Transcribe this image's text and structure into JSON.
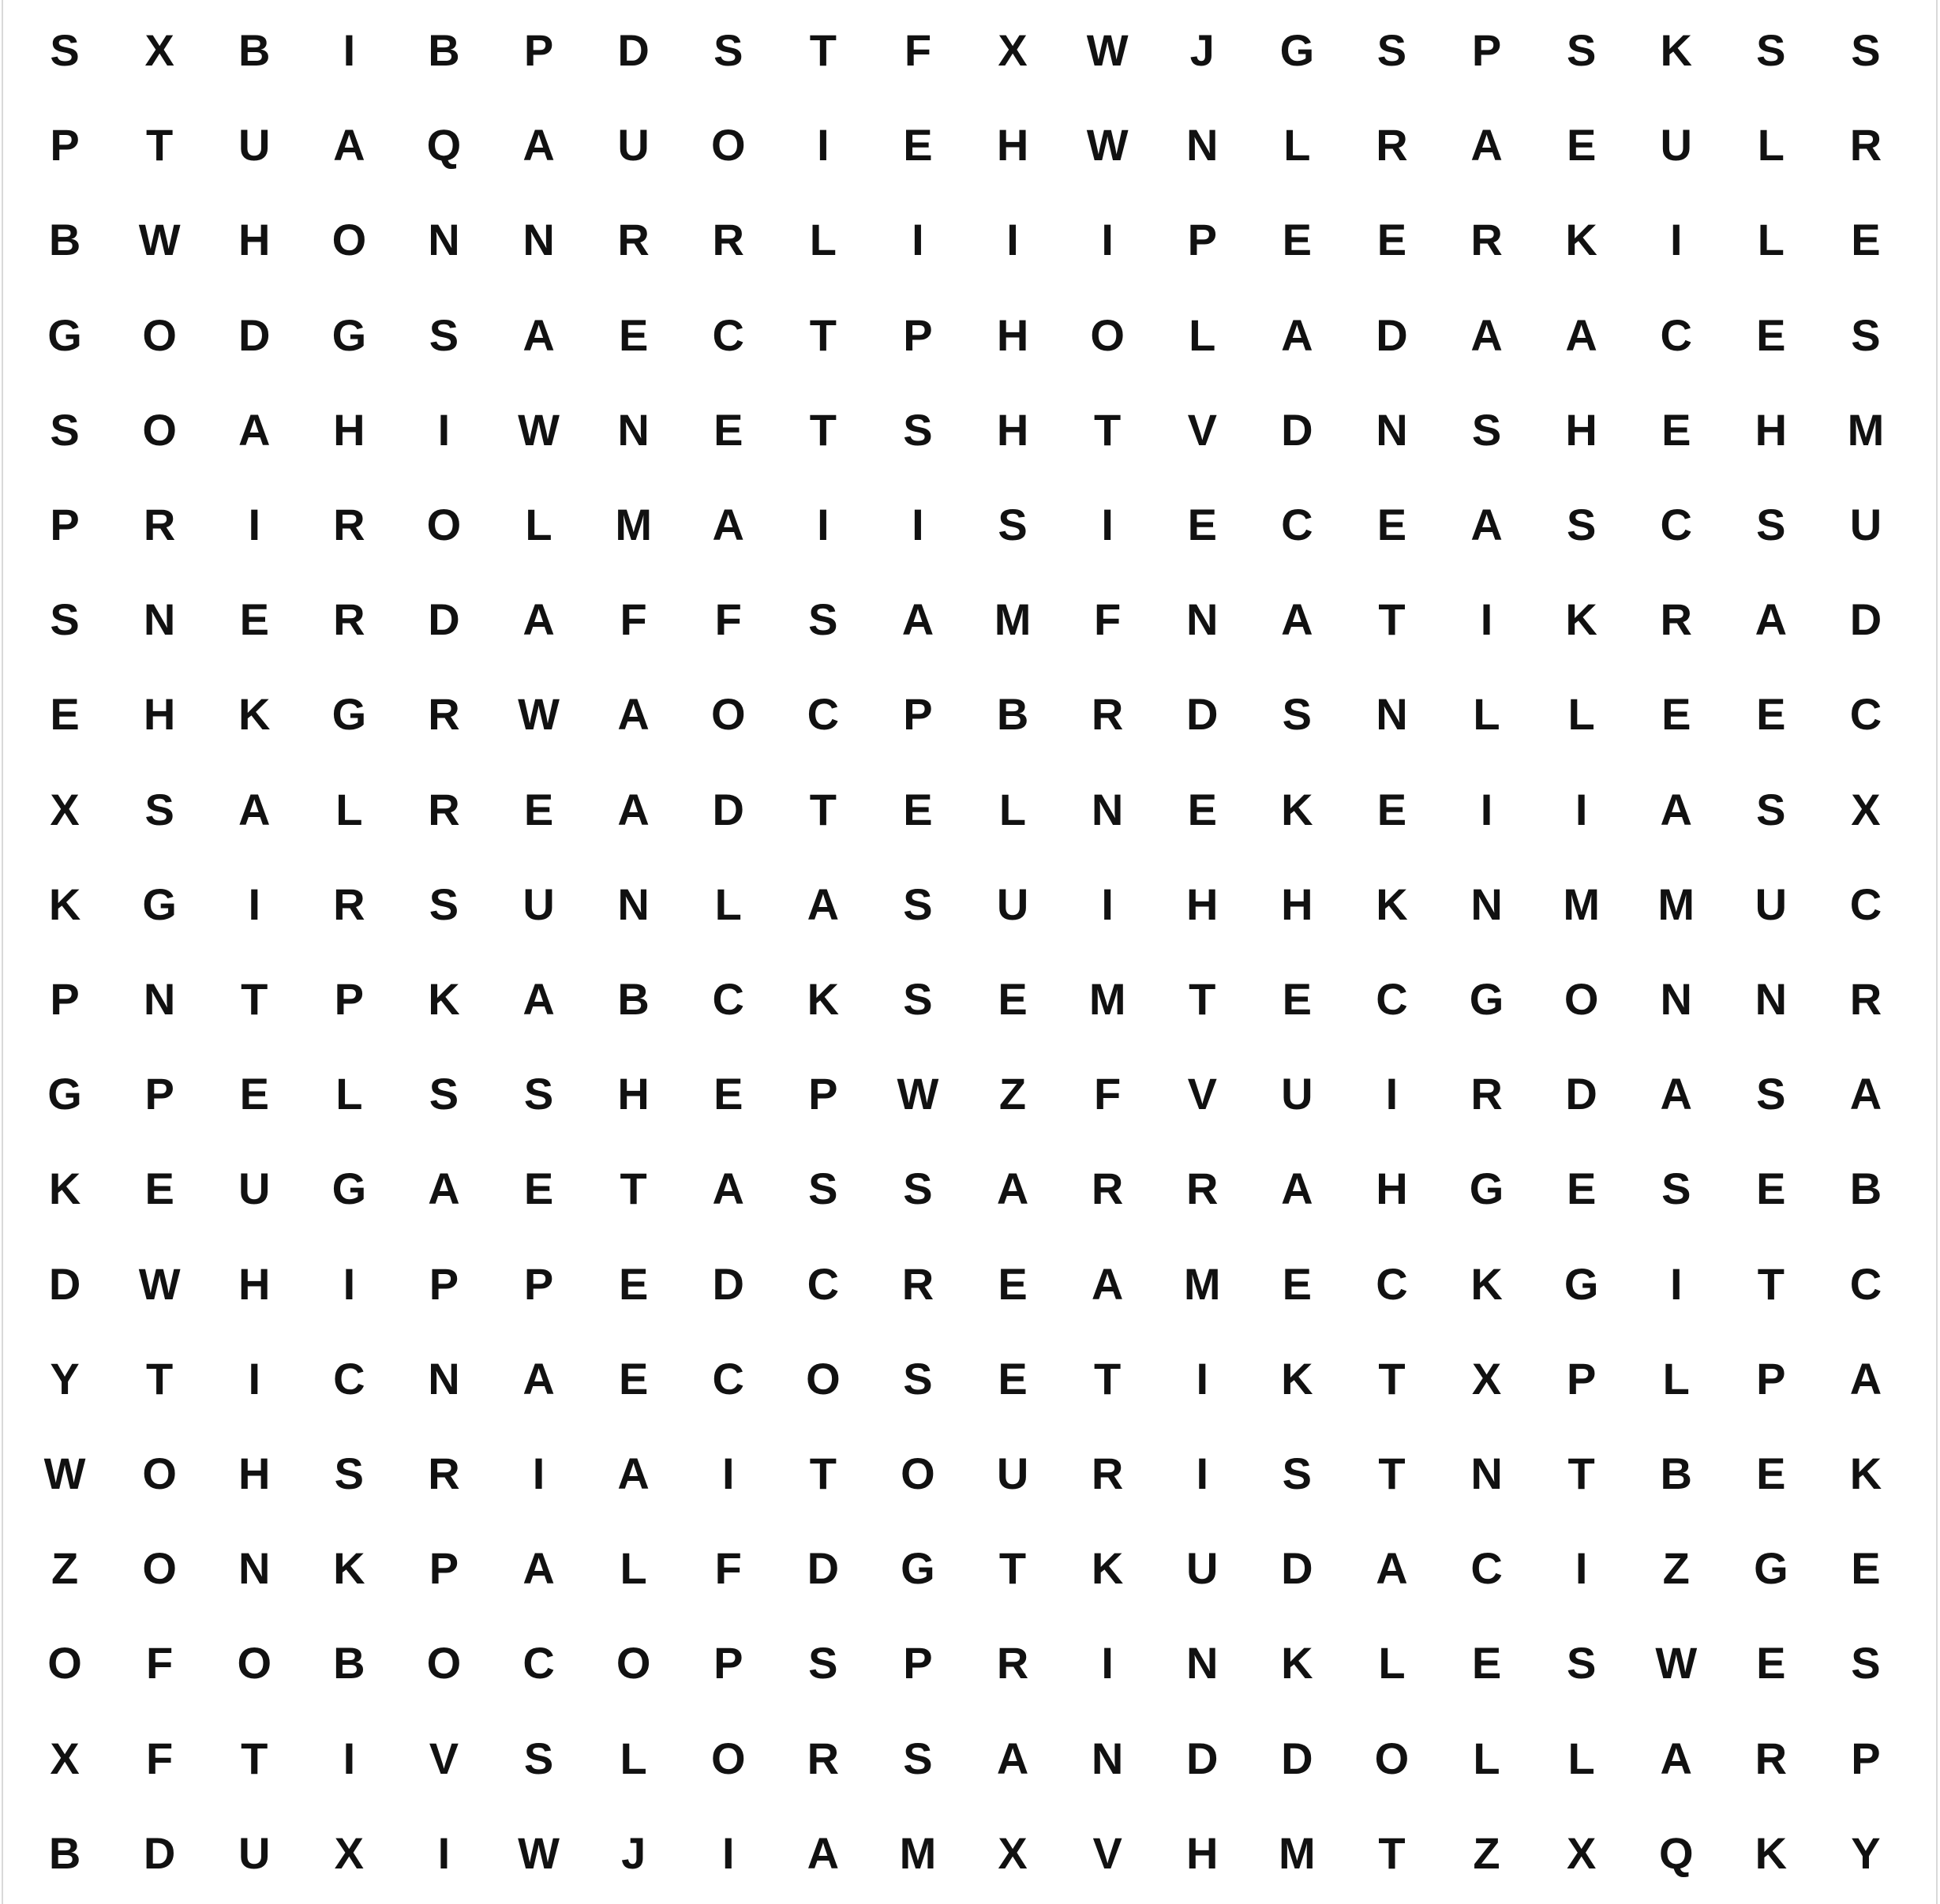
{
  "puzzle": {
    "rows": [
      [
        "S",
        "X",
        "B",
        "I",
        "B",
        "P",
        "D",
        "S",
        "T",
        "F",
        "X",
        "W",
        "J",
        "G",
        "S",
        "P",
        "S",
        "K",
        "S",
        "S"
      ],
      [
        "P",
        "T",
        "U",
        "A",
        "Q",
        "A",
        "U",
        "O",
        "I",
        "E",
        "H",
        "W",
        "N",
        "L",
        "R",
        "A",
        "E",
        "U",
        "L",
        "R"
      ],
      [
        "B",
        "W",
        "H",
        "O",
        "N",
        "N",
        "R",
        "R",
        "L",
        "I",
        "I",
        "I",
        "P",
        "E",
        "E",
        "R",
        "K",
        "I",
        "L",
        "E"
      ],
      [
        "G",
        "O",
        "D",
        "G",
        "S",
        "A",
        "E",
        "C",
        "T",
        "P",
        "H",
        "O",
        "L",
        "A",
        "D",
        "A",
        "A",
        "C",
        "E",
        "S"
      ],
      [
        "S",
        "O",
        "A",
        "H",
        "I",
        "W",
        "N",
        "E",
        "T",
        "S",
        "H",
        "T",
        "V",
        "D",
        "N",
        "S",
        "H",
        "E",
        "H",
        "M"
      ],
      [
        "P",
        "R",
        "I",
        "R",
        "O",
        "L",
        "M",
        "A",
        "I",
        "I",
        "S",
        "I",
        "E",
        "C",
        "E",
        "A",
        "S",
        "C",
        "S",
        "U"
      ],
      [
        "S",
        "N",
        "E",
        "R",
        "D",
        "A",
        "F",
        "F",
        "S",
        "A",
        "M",
        "F",
        "N",
        "A",
        "T",
        "I",
        "K",
        "R",
        "A",
        "D"
      ],
      [
        "E",
        "H",
        "K",
        "G",
        "R",
        "W",
        "A",
        "O",
        "C",
        "P",
        "B",
        "R",
        "D",
        "S",
        "N",
        "L",
        "L",
        "E",
        "E",
        "C"
      ],
      [
        "X",
        "S",
        "A",
        "L",
        "R",
        "E",
        "A",
        "D",
        "T",
        "E",
        "L",
        "N",
        "E",
        "K",
        "E",
        "I",
        "I",
        "A",
        "S",
        "X"
      ],
      [
        "K",
        "G",
        "I",
        "R",
        "S",
        "U",
        "N",
        "L",
        "A",
        "S",
        "U",
        "I",
        "H",
        "H",
        "K",
        "N",
        "M",
        "M",
        "U",
        "C"
      ],
      [
        "P",
        "N",
        "T",
        "P",
        "K",
        "A",
        "B",
        "C",
        "K",
        "S",
        "E",
        "M",
        "T",
        "E",
        "C",
        "G",
        "O",
        "N",
        "N",
        "R"
      ],
      [
        "G",
        "P",
        "E",
        "L",
        "S",
        "S",
        "H",
        "E",
        "P",
        "W",
        "Z",
        "F",
        "V",
        "U",
        "I",
        "R",
        "D",
        "A",
        "S",
        "A"
      ],
      [
        "K",
        "E",
        "U",
        "G",
        "A",
        "E",
        "T",
        "A",
        "S",
        "S",
        "A",
        "R",
        "R",
        "A",
        "H",
        "G",
        "E",
        "S",
        "E",
        "B"
      ],
      [
        "D",
        "W",
        "H",
        "I",
        "P",
        "P",
        "E",
        "D",
        "C",
        "R",
        "E",
        "A",
        "M",
        "E",
        "C",
        "K",
        "G",
        "I",
        "T",
        "C"
      ],
      [
        "Y",
        "T",
        "I",
        "C",
        "N",
        "A",
        "E",
        "C",
        "O",
        "S",
        "E",
        "T",
        "I",
        "K",
        "T",
        "X",
        "P",
        "L",
        "P",
        "A"
      ],
      [
        "W",
        "O",
        "H",
        "S",
        "R",
        "I",
        "A",
        "I",
        "T",
        "O",
        "U",
        "R",
        "I",
        "S",
        "T",
        "N",
        "T",
        "B",
        "E",
        "K"
      ],
      [
        "Z",
        "O",
        "N",
        "K",
        "P",
        "A",
        "L",
        "F",
        "D",
        "G",
        "T",
        "K",
        "U",
        "D",
        "A",
        "C",
        "I",
        "Z",
        "G",
        "E"
      ],
      [
        "O",
        "F",
        "O",
        "B",
        "O",
        "C",
        "O",
        "P",
        "S",
        "P",
        "R",
        "I",
        "N",
        "K",
        "L",
        "E",
        "S",
        "W",
        "E",
        "S"
      ],
      [
        "X",
        "F",
        "T",
        "I",
        "V",
        "S",
        "L",
        "O",
        "R",
        "S",
        "A",
        "N",
        "D",
        "D",
        "O",
        "L",
        "L",
        "A",
        "R",
        "P"
      ],
      [
        "B",
        "D",
        "U",
        "X",
        "I",
        "W",
        "J",
        "I",
        "A",
        "M",
        "X",
        "V",
        "H",
        "M",
        "T",
        "Z",
        "X",
        "Q",
        "K",
        "Y"
      ]
    ]
  }
}
